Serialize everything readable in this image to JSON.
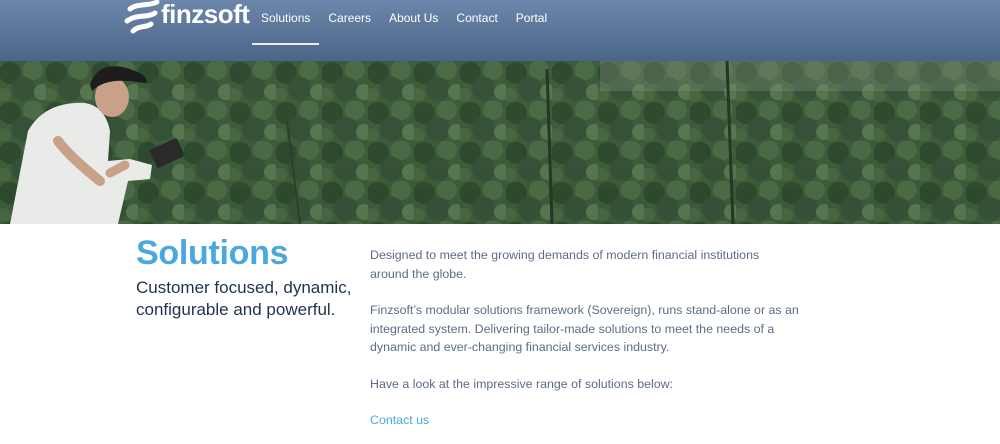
{
  "header": {
    "logo_text": "finzsoft",
    "nav": [
      {
        "label": "Solutions",
        "active": true
      },
      {
        "label": "Careers",
        "active": false
      },
      {
        "label": "About Us",
        "active": false
      },
      {
        "label": "Contact",
        "active": false
      },
      {
        "label": "Portal",
        "active": false
      }
    ]
  },
  "hero": {
    "image": "man-with-tablet-over-forest"
  },
  "main": {
    "title": "Solutions",
    "tagline": "Customer focused, dynamic, configurable and powerful.",
    "paragraphs": [
      "Designed to meet the growing demands of modern financial institutions around the globe.",
      "Finzsoft’s modular solutions framework (Sovereign), runs stand-alone or as an integrated system.  Delivering tailor-made solutions to meet the needs of a dynamic and ever-changing financial services industry.",
      "Have a look at the impressive range of solutions below:"
    ],
    "contact_link": "Contact us"
  },
  "colors": {
    "header": "#5a7497",
    "accent": "#4aa8dc",
    "heading_dark": "#1f3350",
    "body_text": "#5c6d86"
  }
}
